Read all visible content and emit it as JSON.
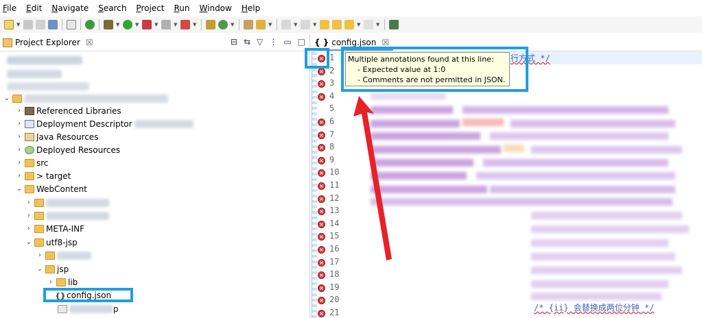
{
  "menu": [
    "File",
    "Edit",
    "Navigate",
    "Search",
    "Project",
    "Run",
    "Window",
    "Help"
  ],
  "explorer": {
    "title": "Project Explorer",
    "close_label": "☒",
    "items": [
      {
        "label": "Referenced Libraries"
      },
      {
        "label": "Deployment Descriptor"
      },
      {
        "label": "Java Resources"
      },
      {
        "label": "Deployed Resources"
      },
      {
        "label": "src"
      },
      {
        "label": "> target"
      },
      {
        "label": "WebContent"
      },
      {
        "label": "META-INF"
      },
      {
        "label": "utf8-jsp"
      },
      {
        "label": "jsp"
      },
      {
        "label": "lib"
      },
      {
        "label": "config.json"
      },
      {
        "label": "p"
      }
    ]
  },
  "editor": {
    "tab_label": "config.json",
    "tab_close": "☒",
    "line_numbers": [
      "1",
      "2",
      "3",
      "4",
      "5",
      "6",
      "7",
      "8",
      "9",
      "10",
      "11",
      "12",
      "13",
      "14",
      "15",
      "16",
      "17",
      "18",
      "19",
      "20",
      "21"
    ],
    "line1_tail": "行方式 */",
    "line21_comment": "/* {ii} 会替换成两位分钟 */"
  },
  "tooltip": {
    "title": "Multiple annotations found at this line:",
    "items": [
      "- Expected value at 1:0",
      "- Comments are not permitted in JSON."
    ]
  },
  "colors": {
    "annotation_box": "#1e9fe0",
    "arrow": "#e8202a",
    "error": "#d43b3b"
  }
}
